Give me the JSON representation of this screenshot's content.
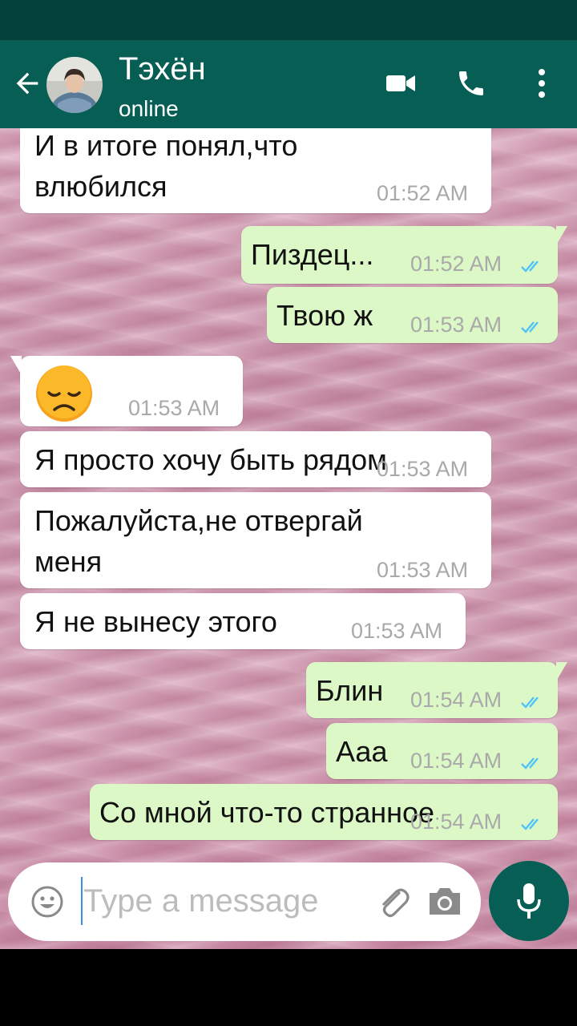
{
  "header": {
    "contact_name": "Тэхён",
    "status": "online"
  },
  "messages": [
    {
      "direction": "in",
      "text_lines": [
        "И в итоге понял,что",
        "влюбился"
      ],
      "time": "01:52 AM"
    },
    {
      "direction": "out",
      "text_lines": [
        "Пиздец..."
      ],
      "time": "01:52 AM",
      "read": true
    },
    {
      "direction": "out",
      "text_lines": [
        "Твою ж"
      ],
      "time": "01:53 AM",
      "read": true
    },
    {
      "direction": "in",
      "emoji": "disappointed-face",
      "time": "01:53 AM"
    },
    {
      "direction": "in",
      "text_lines": [
        "Я просто хочу быть рядом"
      ],
      "time": "01:53 AM"
    },
    {
      "direction": "in",
      "text_lines": [
        "Пожалуйста,не отвергай",
        "меня"
      ],
      "time": "01:53 AM"
    },
    {
      "direction": "in",
      "text_lines": [
        "Я не вынесу этого"
      ],
      "time": "01:53 AM"
    },
    {
      "direction": "out",
      "text_lines": [
        "Блин"
      ],
      "time": "01:54 AM",
      "read": true
    },
    {
      "direction": "out",
      "text_lines": [
        "Ааа"
      ],
      "time": "01:54 AM",
      "read": true
    },
    {
      "direction": "out",
      "text_lines": [
        "Со мной что-то странное"
      ],
      "time": "01:54 AM",
      "read": true
    }
  ],
  "composer": {
    "placeholder": "Type a message"
  },
  "colors": {
    "header": "#075e54",
    "outgoing_bubble": "#dcf8c6",
    "incoming_bubble": "#ffffff",
    "read_ticks": "#4fc3f7"
  },
  "icons": {
    "back": "arrow-left-icon",
    "video": "video-camera-icon",
    "call": "phone-icon",
    "menu": "more-vertical-icon",
    "emoji": "smiley-icon",
    "attach": "paperclip-icon",
    "camera": "camera-icon",
    "mic": "microphone-icon"
  }
}
